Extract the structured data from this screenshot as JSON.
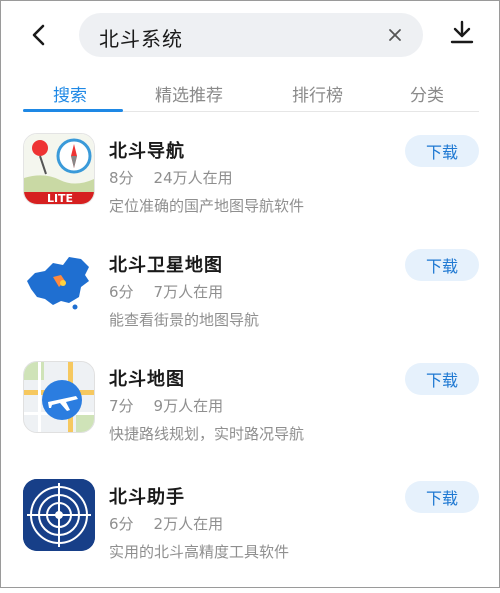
{
  "search": {
    "value": "北斗系统"
  },
  "tabs": [
    {
      "label": "搜索",
      "active": true
    },
    {
      "label": "精选推荐",
      "active": false
    },
    {
      "label": "排行榜",
      "active": false
    },
    {
      "label": "分类",
      "active": false
    }
  ],
  "apps": [
    {
      "name": "北斗导航",
      "rating": "8分",
      "users": "24万人在用",
      "description": "定位准确的国产地图导航软件",
      "button": "下载",
      "icon": "compass-map-lite-icon",
      "icon_badge": "LITE"
    },
    {
      "name": "北斗卫星地图",
      "rating": "6分",
      "users": "7万人在用",
      "description": "能查看街景的地图导航",
      "button": "下载",
      "icon": "china-map-icon"
    },
    {
      "name": "北斗地图",
      "rating": "7分",
      "users": "9万人在用",
      "description": "快捷路线规划，实时路况导航",
      "button": "下载",
      "icon": "plane-map-icon"
    },
    {
      "name": "北斗助手",
      "rating": "6分",
      "users": "2万人在用",
      "description": "实用的北斗高精度工具软件",
      "button": "下载",
      "icon": "radar-target-icon"
    }
  ],
  "colors": {
    "accent": "#1e88e5",
    "button_bg": "#e6f1fc",
    "search_bg": "#eef0f3"
  }
}
